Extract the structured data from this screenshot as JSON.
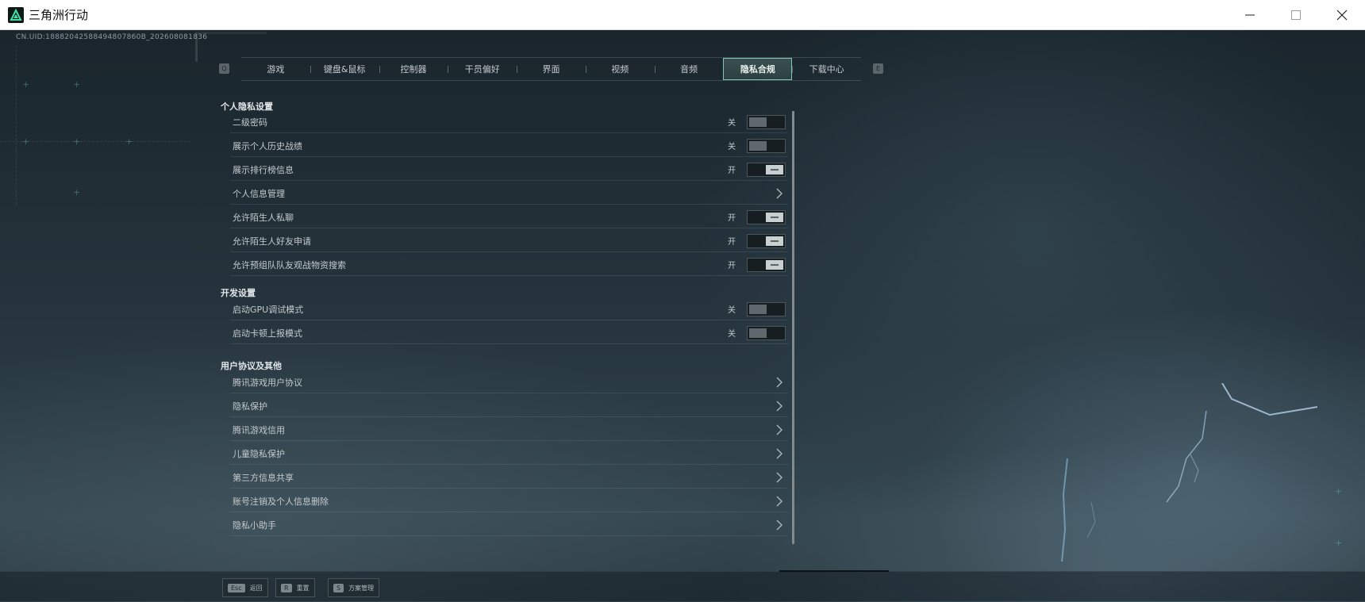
{
  "window": {
    "title": "三角洲行动",
    "controls": {
      "minimize": "—",
      "maximize": "☐",
      "close": "✕"
    }
  },
  "uid": "CN.UID:18882042588494807860B_202608081836",
  "tabbar": {
    "left_key": "Q",
    "right_key": "E",
    "tabs": [
      "游戏",
      "键盘&鼠标",
      "控制器",
      "干员偏好",
      "界面",
      "视频",
      "音频",
      "隐私合规",
      "下载中心"
    ],
    "active_index": 7
  },
  "sections": {
    "privacy": {
      "title": "个人隐私设置",
      "rows": [
        {
          "label": "二级密码",
          "state": "关",
          "type": "toggle",
          "on": false
        },
        {
          "label": "展示个人历史战绩",
          "state": "关",
          "type": "toggle",
          "on": false
        },
        {
          "label": "展示排行榜信息",
          "state": "开",
          "type": "toggle",
          "on": true
        },
        {
          "label": "个人信息管理",
          "type": "link"
        },
        {
          "label": "允许陌生人私聊",
          "state": "开",
          "type": "toggle",
          "on": true
        },
        {
          "label": "允许陌生人好友申请",
          "state": "开",
          "type": "toggle",
          "on": true
        },
        {
          "label": "允许预组队队友观战物资搜索",
          "state": "开",
          "type": "toggle",
          "on": true
        }
      ]
    },
    "dev": {
      "title": "开发设置",
      "rows": [
        {
          "label": "启动GPU调试模式",
          "state": "关",
          "type": "toggle",
          "on": false
        },
        {
          "label": "启动卡顿上报模式",
          "state": "关",
          "type": "toggle",
          "on": false
        }
      ]
    },
    "agreements": {
      "title": "用户协议及其他",
      "rows": [
        {
          "label": "腾讯游戏用户协议",
          "type": "link"
        },
        {
          "label": "隐私保护",
          "type": "link"
        },
        {
          "label": "腾讯游戏信用",
          "type": "link"
        },
        {
          "label": "儿童隐私保护",
          "type": "link"
        },
        {
          "label": "第三方信息共享",
          "type": "link"
        },
        {
          "label": "账号注销及个人信息删除",
          "type": "link"
        },
        {
          "label": "隐私小助手",
          "type": "link"
        }
      ]
    }
  },
  "bottom_hints": [
    {
      "key": "Esc",
      "label": "返回"
    },
    {
      "key": "R",
      "label": "重置"
    },
    {
      "key": "S",
      "label": "方案管理"
    }
  ],
  "colors": {
    "accent": "#7fc5b0",
    "background": "#1e2a31",
    "text": "#c4cbce"
  }
}
